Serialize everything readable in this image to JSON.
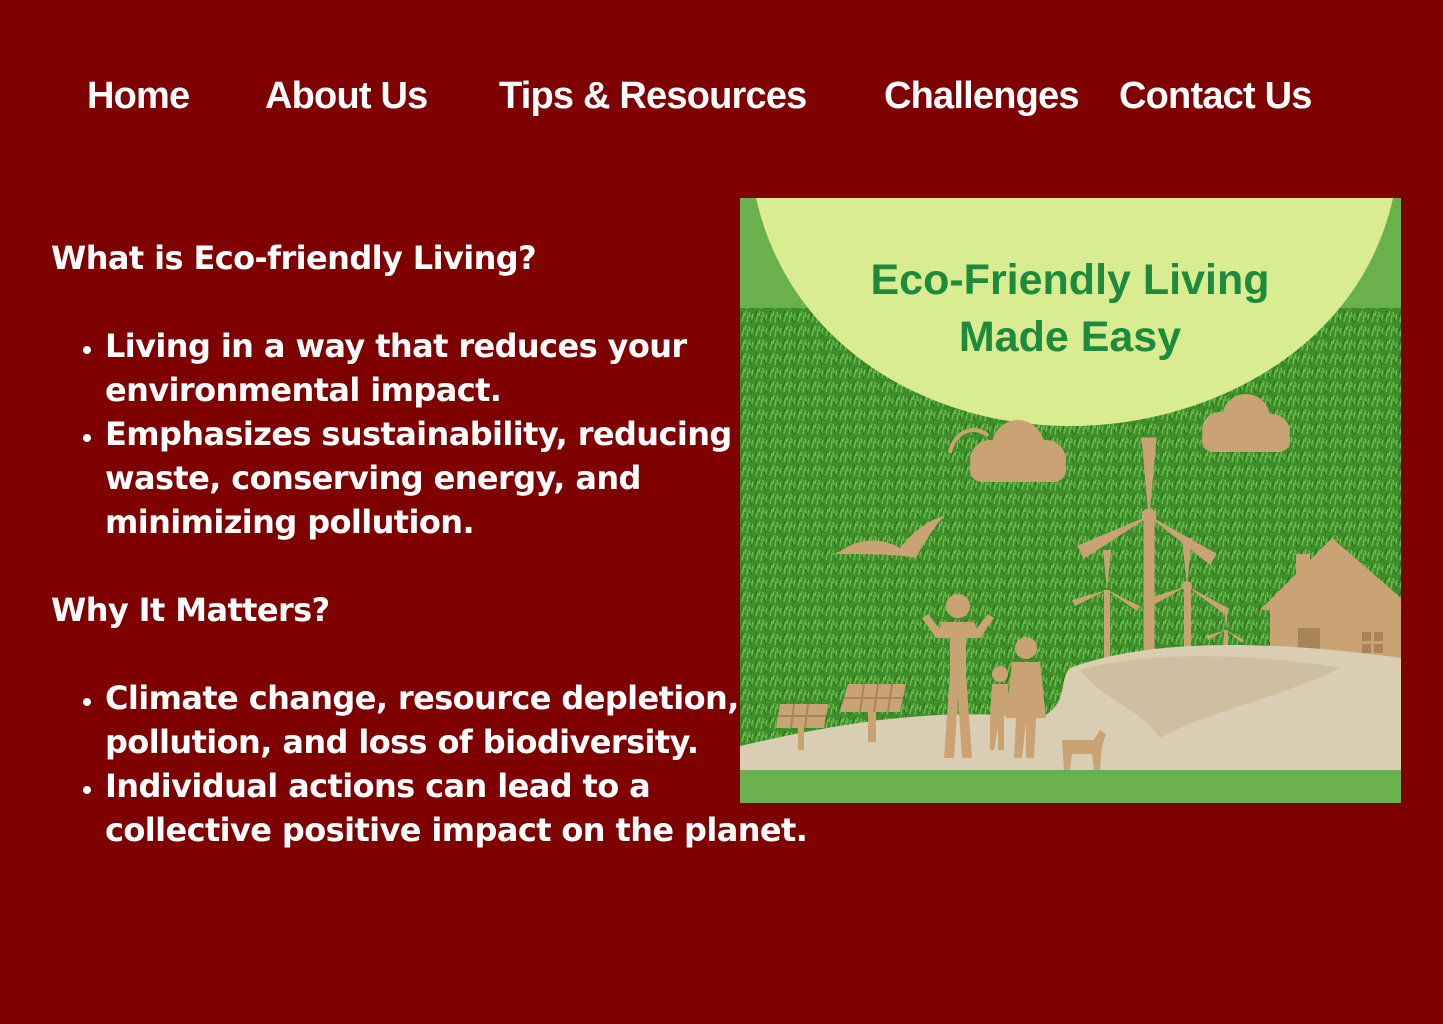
{
  "nav": {
    "items": [
      {
        "label": "Home"
      },
      {
        "label": "About Us"
      },
      {
        "label": "Tips & Resources"
      },
      {
        "label": "Challenges"
      },
      {
        "label": "Contact Us"
      }
    ]
  },
  "section1": {
    "heading": "What is Eco-friendly Living?",
    "bullets": [
      "Living in a way that reduces your environmental impact.",
      "Emphasizes sustainability, reducing waste, conserving energy, and minimizing pollution."
    ]
  },
  "section2": {
    "heading": "Why It Matters?",
    "bullets": [
      "Climate change, resource depletion, pollution, and loss of biodiversity.",
      "Individual actions can lead to a collective positive impact on the planet."
    ]
  },
  "hero": {
    "title_line1": "Eco-Friendly Living",
    "title_line2": "Made Easy"
  },
  "colors": {
    "background": "#7f0000",
    "text": "#ffffff",
    "hero_title": "#1e8a3c",
    "hero_arc": "#d9ec91",
    "hero_grass": "#3f8e2c",
    "hero_frame": "#6ab04c",
    "cardboard": "#caa374"
  }
}
